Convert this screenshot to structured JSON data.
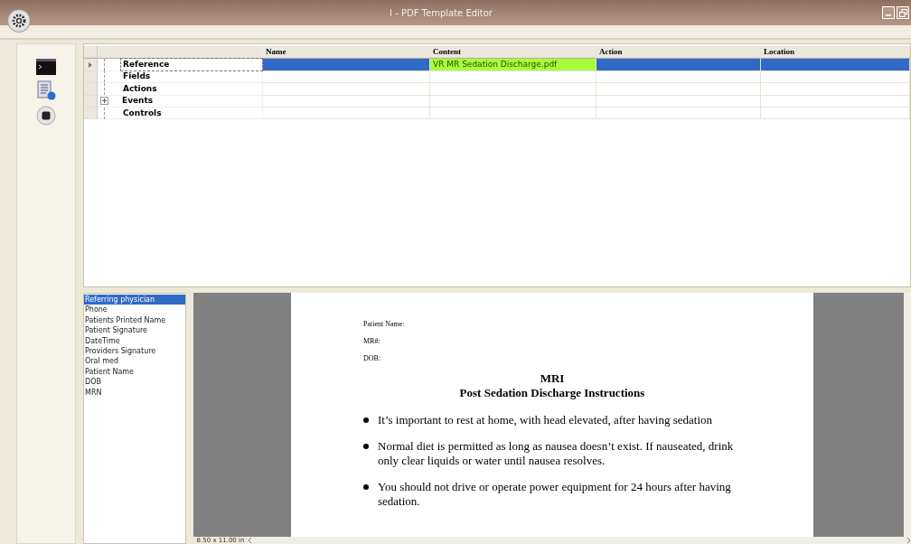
{
  "window": {
    "title": "I - PDF Template Editor"
  },
  "toolbar": [
    {
      "kind": "console"
    },
    {
      "kind": "script"
    },
    {
      "kind": "stop"
    }
  ],
  "grid": {
    "columns": [
      "Name",
      "Content",
      "Action",
      "Location"
    ],
    "rows": [
      {
        "label": "Reference",
        "selected": true,
        "expandable": false,
        "cells": [
          "",
          "VR MR Sedation Discharge.pdf",
          "",
          ""
        ],
        "content_highlighted": true
      },
      {
        "label": "Fields",
        "selected": false,
        "expandable": false,
        "cells": [
          "",
          "",
          "",
          ""
        ],
        "content_highlighted": false
      },
      {
        "label": "Actions",
        "selected": false,
        "expandable": false,
        "cells": [
          "",
          "",
          "",
          ""
        ],
        "content_highlighted": false
      },
      {
        "label": "Events",
        "selected": false,
        "expandable": true,
        "cells": [
          "",
          "",
          "",
          ""
        ],
        "content_highlighted": false
      },
      {
        "label": "Controls",
        "selected": false,
        "expandable": false,
        "cells": [
          "",
          "",
          "",
          ""
        ],
        "content_highlighted": false
      }
    ]
  },
  "fields": [
    {
      "label": "Referring physician",
      "selected": true
    },
    {
      "label": "Phone",
      "selected": false
    },
    {
      "label": "Patients Printed Name",
      "selected": false
    },
    {
      "label": "Patient Signature",
      "selected": false
    },
    {
      "label": "DateTime",
      "selected": false
    },
    {
      "label": "Providers Signature",
      "selected": false
    },
    {
      "label": "Oral med",
      "selected": false
    },
    {
      "label": "Patient Name",
      "selected": false
    },
    {
      "label": "DOB",
      "selected": false
    },
    {
      "label": "MRN",
      "selected": false
    }
  ],
  "document": {
    "header_fields": [
      "Patient Name:",
      "MR#:",
      "DOB:"
    ],
    "title": "MRI",
    "subtitle": "Post Sedation Discharge Instructions",
    "bullets": [
      "It’s important to rest at home, with head elevated, after having sedation",
      "Normal diet is permitted as long as nausea doesn’t exist.  If nauseated, drink only clear liquids or water until nausea resolves.",
      "You should not drive or operate power equipment for 24 hours after having sedation."
    ]
  },
  "status": {
    "page_size": "8.50 x 11.00 in"
  }
}
